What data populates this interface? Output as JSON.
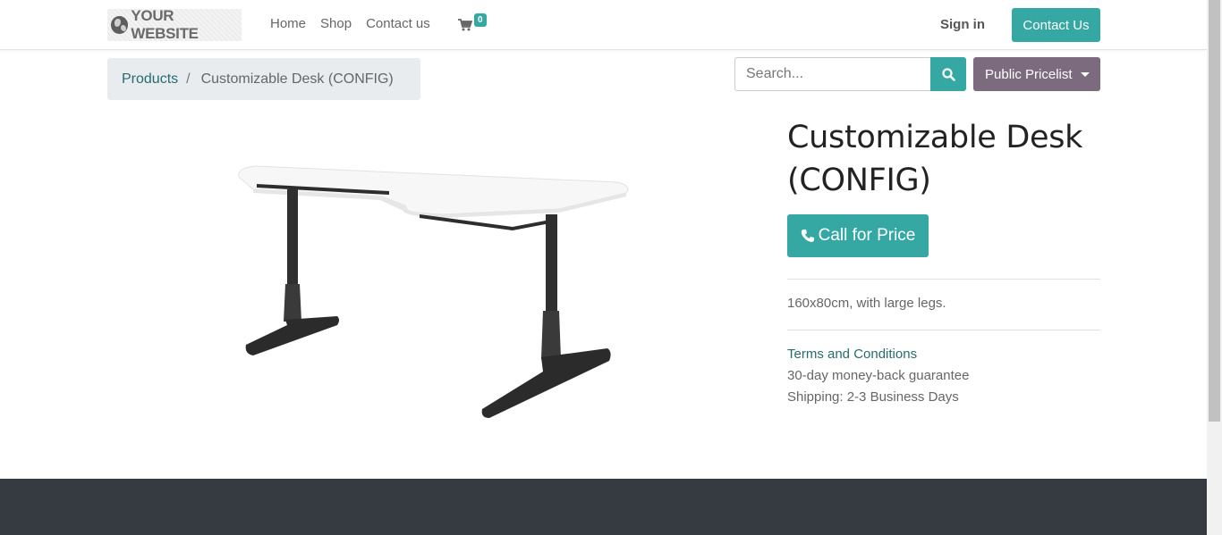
{
  "header": {
    "logo_text": "YOUR WEBSITE",
    "nav": [
      "Home",
      "Shop",
      "Contact us"
    ],
    "cart_count": "0",
    "signin_label": "Sign in",
    "contact_label": "Contact Us"
  },
  "breadcrumb": {
    "parent": "Products",
    "separator": "/",
    "current": "Customizable Desk (CONFIG)"
  },
  "search": {
    "placeholder": "Search..."
  },
  "pricelist": {
    "label": "Public Pricelist"
  },
  "product": {
    "title": "Customizable Desk (CONFIG)",
    "call_label": "Call for Price",
    "description": "160x80cm, with large legs.",
    "terms_label": "Terms and Conditions",
    "terms_lines": [
      "30-day money-back guarantee",
      "Shipping: 2-3 Business Days"
    ]
  },
  "colors": {
    "accent": "#35a8a4",
    "pricelist": "#7c6a7f",
    "footer": "#363b42",
    "link": "#276b70"
  }
}
